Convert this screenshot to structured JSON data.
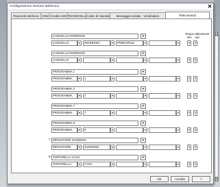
{
  "dialog": {
    "title": "Configurazione sezione telefonica",
    "close_icon": "close-icon"
  },
  "tabs": [
    {
      "label": "Parametri telefonici"
    },
    {
      "label": "GSM"
    },
    {
      "label": "Credito SIM"
    },
    {
      "label": "TECNOCELL"
    },
    {
      "label": "Codici di risposta"
    },
    {
      "label": "Messaggio iniziale - Vocabolario"
    },
    {
      "label": "Telecomandi"
    }
  ],
  "active_tab": "Telecomandi",
  "header": {
    "tempo_label": "Tempo attivazione",
    "min_label": "min",
    "sec_label": "sec"
  },
  "groups": [
    {
      "number": "",
      "name": "CANCELLO INGRESSO",
      "type": "CANCELLO",
      "device": "INGRESSO",
      "extra": "PRINCIPALE",
      "min": "0",
      "sec": "0"
    },
    {
      "number": "",
      "name": "CANCELLO INGRESSO",
      "type": "CANCELLO",
      "device": "",
      "extra": "",
      "min": "0",
      "sec": "0"
    },
    {
      "number": "",
      "name": "PROGRAMMA 1",
      "type": "PROGRAMMA",
      "device": "1",
      "extra": "",
      "min": "0",
      "sec": "0"
    },
    {
      "number": "",
      "name": "PROGRAMMA 2",
      "type": "PROGRAMMA",
      "device": "2",
      "extra": "",
      "min": "0",
      "sec": "0"
    },
    {
      "number": "",
      "name": "PROGRAMMA 7",
      "type": "PROGRAMMA",
      "device": "7",
      "extra": "",
      "min": "0",
      "sec": "0"
    },
    {
      "number": "",
      "name": "PROGRAMMA 8",
      "type": "PROGRAMMA",
      "device": "8",
      "extra": "",
      "min": "0",
      "sec": "0"
    },
    {
      "number": "7",
      "name": "IRRIGATORE GIARDINO",
      "type": "IRRIGATORE",
      "device": "GIARDINO",
      "extra": "",
      "min": "0",
      "sec": "0"
    },
    {
      "number": "8",
      "name": "TAPPARELLA CASA",
      "type": "TAPPARELLA",
      "device": "CASA",
      "extra": "",
      "min": "0",
      "sec": "0"
    }
  ],
  "buttons": {
    "ok": "OK",
    "annulla": "Annulla",
    "help": "?"
  }
}
